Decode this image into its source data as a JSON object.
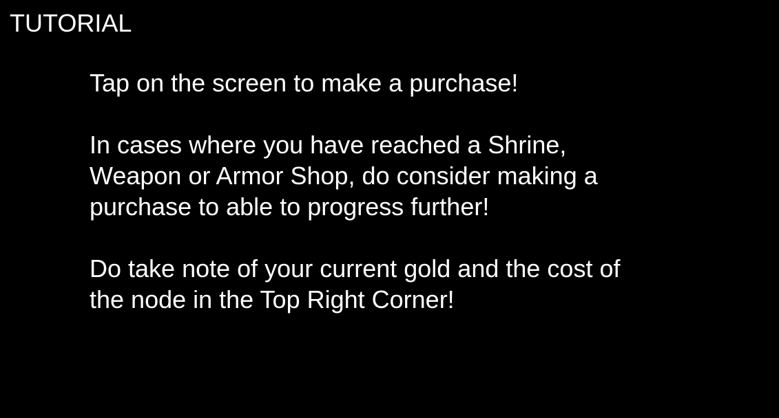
{
  "title": "TUTORIAL",
  "paragraphs": [
    [
      "Tap on the screen to make a purchase!"
    ],
    [
      "In cases where you have reached a Shrine,",
      "Weapon or Armor Shop, do consider making a",
      "purchase to able to progress further!"
    ],
    [
      "Do take note of your current gold and the cost of",
      "the node in the Top Right Corner!"
    ]
  ],
  "colors": {
    "background": "#000000",
    "text": "#ffffff"
  }
}
